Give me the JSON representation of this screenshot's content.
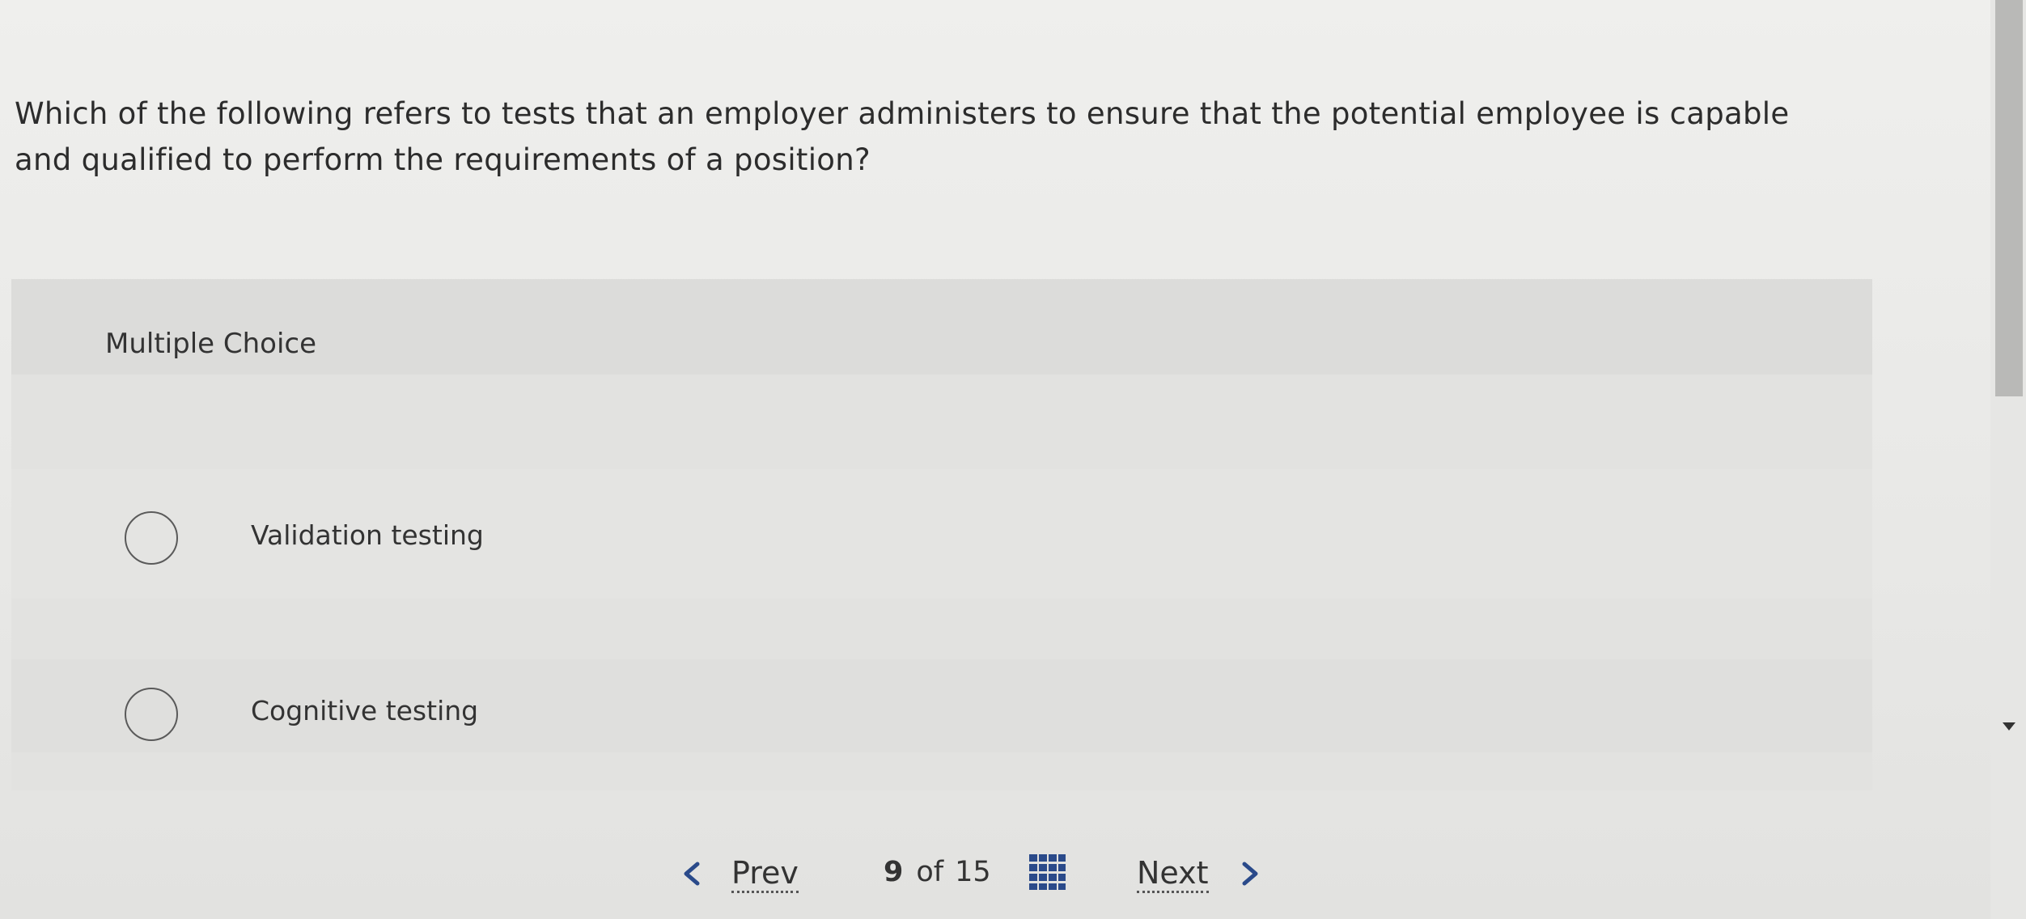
{
  "question": {
    "text": "Which of the following refers to tests that an employer administers to ensure that the potential employee is capable and qualified to perform the requirements of a position?"
  },
  "multiple_choice": {
    "label": "Multiple Choice",
    "options": [
      {
        "label": "Validation testing",
        "selected": false
      },
      {
        "label": "Cognitive testing",
        "selected": false
      }
    ]
  },
  "navigation": {
    "prev_label": "Prev",
    "next_label": "Next",
    "current_page": "9",
    "of_label": "of",
    "total_pages": "15",
    "icons": {
      "prev": "chevron-left-icon",
      "next": "chevron-right-icon",
      "grid": "grid-icon"
    }
  },
  "colors": {
    "page_background": "#e9e9e7",
    "panel_background": "#e2e2e0",
    "text": "#2f2f2f",
    "scroll_thumb": "#b9b9b7"
  }
}
